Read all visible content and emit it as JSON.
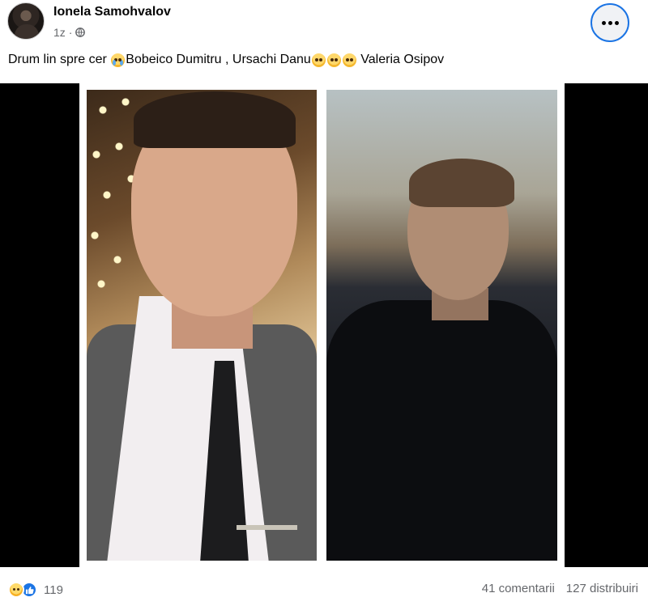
{
  "post": {
    "author": "Ionela Samohvalov",
    "time": "1z",
    "privacy_icon": "globe-icon",
    "more_icon": "more-options-icon",
    "caption": {
      "prefix": "Drum lin spre cer",
      "emoji1": "crying-face-emoji",
      "mention1": "Bobeico Dumitru",
      "sep": " , ",
      "mention2": "Ursachi Danu",
      "emoji2": "pleading-face-emoji",
      "emoji3": "pleading-face-emoji",
      "emoji4": "pleading-face-emoji",
      "mention3": "Valeria Osipov"
    }
  },
  "media": {
    "photos": [
      "photo-left-man-in-suit",
      "photo-right-young-man-dark-hoodie"
    ]
  },
  "footer": {
    "reaction_icons": [
      "sad-reaction-icon",
      "like-reaction-icon"
    ],
    "reaction_count": "119",
    "comments": "41 comentarii",
    "shares": "127 distribuiri"
  },
  "colors": {
    "accent": "#1b74e4",
    "secondary_text": "#65676b",
    "text": "#050505",
    "media_background": "#000000"
  }
}
